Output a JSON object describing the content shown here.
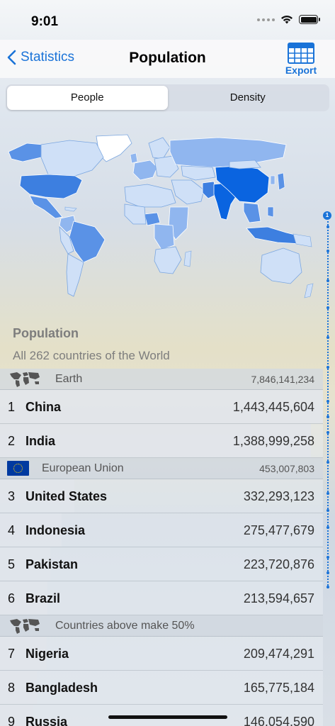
{
  "status_bar": {
    "time": "9:01"
  },
  "navbar": {
    "back_label": "Statistics",
    "title": "Population",
    "export_label": "Export"
  },
  "segments": [
    {
      "label": "People"
    },
    {
      "label": "Density"
    }
  ],
  "scroll_index": {
    "badge": "1"
  },
  "section": {
    "title": "Population",
    "subtitle": "All 262 countries of the World"
  },
  "groups": {
    "earth": {
      "label": "Earth",
      "value": "7,846,141,234"
    },
    "eu": {
      "label": "European Union",
      "value": "453,007,803"
    },
    "half": {
      "label": "Countries above make 50%"
    }
  },
  "rows": [
    {
      "rank": "1",
      "name": "China",
      "value": "1,443,445,604",
      "fraction": 1.0
    },
    {
      "rank": "2",
      "name": "India",
      "value": "1,388,999,258",
      "fraction": 0.962
    },
    {
      "rank": "3",
      "name": "United States",
      "value": "332,293,123",
      "fraction": 0.23
    },
    {
      "rank": "4",
      "name": "Indonesia",
      "value": "275,477,679",
      "fraction": 0.191
    },
    {
      "rank": "5",
      "name": "Pakistan",
      "value": "223,720,876",
      "fraction": 0.155
    },
    {
      "rank": "6",
      "name": "Brazil",
      "value": "213,594,657",
      "fraction": 0.148
    },
    {
      "rank": "7",
      "name": "Nigeria",
      "value": "209,474,291",
      "fraction": 0.145
    },
    {
      "rank": "8",
      "name": "Bangladesh",
      "value": "165,775,184",
      "fraction": 0.115
    },
    {
      "rank": "9",
      "name": "Russia",
      "value": "146,054,590",
      "fraction": 0.101
    }
  ],
  "colors": {
    "accent": "#1a73d8",
    "map_high": "#0a64e0",
    "map_mid": "#5a92e6",
    "map_low": "#cfe0f7"
  },
  "icons": {
    "back": "chevron-left-icon",
    "export": "spreadsheet-icon",
    "earth": "world-map-icon",
    "eu": "eu-flag-icon"
  }
}
